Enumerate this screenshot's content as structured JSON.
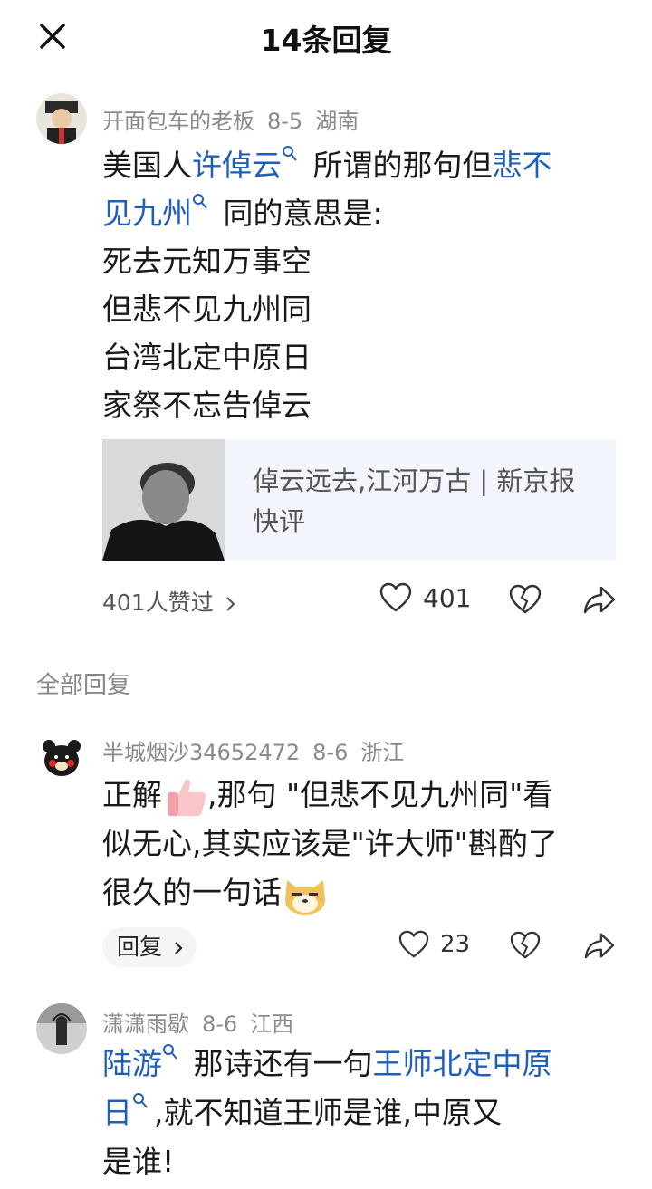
{
  "header": {
    "title": "14条回复"
  },
  "main_comment": {
    "username": "开面包车的老板",
    "date": "8-5",
    "location": "湖南",
    "text_parts": {
      "p1": "美国人",
      "link1": "许倬云",
      "p2": " 所谓的那句但",
      "link2a": "悲不",
      "link2b": "见九州",
      "p3": " 同的意思是:"
    },
    "poem": [
      "死去元知万事空",
      "但悲不见九州同",
      "台湾北定中原日",
      "家祭不忘告倬云"
    ],
    "card_title": "倬云远去,江河万古 | 新京报快评",
    "likes_text": "401人赞过",
    "like_count": "401"
  },
  "section_label": "全部回复",
  "replies": [
    {
      "username": "半城烟沙34652472",
      "date": "8-6",
      "location": "浙江",
      "text_line1a": "正解",
      "text_line1b": ",那句 \"但悲不见九州同\"看",
      "text_line2": "似无心,其实应该是\"许大师\"斟酌了",
      "text_line3": "很久的一句话",
      "reply_label": "回复",
      "like_count": "23"
    },
    {
      "username": "潇潇雨歇",
      "date": "8-6",
      "location": "江西",
      "link1": "陆游",
      "p1": " 那诗还有一句",
      "link2a": "王师北定中原",
      "link2b": "日",
      "p2": ",就不知道王师是谁,中原又",
      "p3": "是谁!"
    }
  ],
  "icons": {
    "close": "close-icon",
    "search": "search-icon",
    "heart": "heart-icon",
    "dislike": "broken-heart-icon",
    "share": "share-icon",
    "chevron": "chevron-right-icon"
  },
  "colors": {
    "link": "#1f5fb8",
    "meta": "#8a8a8a"
  }
}
